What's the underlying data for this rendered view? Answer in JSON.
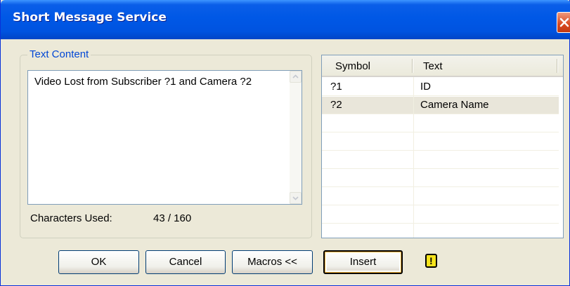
{
  "window": {
    "title": "Short Message Service"
  },
  "text_content": {
    "legend": "Text Content",
    "message": "Video Lost from Subscriber ?1 and Camera ?2",
    "chars_label": "Characters Used:",
    "chars_value": "43 / 160"
  },
  "macros_table": {
    "headers": [
      "Symbol",
      "Text"
    ],
    "rows": [
      {
        "symbol": "?1",
        "text": "ID",
        "selected": false
      },
      {
        "symbol": "?2",
        "text": "Camera Name",
        "selected": true
      }
    ]
  },
  "buttons": {
    "ok": "OK",
    "cancel": "Cancel",
    "macros": "Macros <<",
    "insert": "Insert"
  },
  "icons": {
    "close": "close-icon",
    "warning": "warning-icon"
  },
  "colors": {
    "titlebar": "#0058E6",
    "dialog_bg": "#ECE9D8",
    "legend_text": "#0046D5",
    "selected_row": "#E9E6DA",
    "warning_icon": "#F6E41C"
  }
}
